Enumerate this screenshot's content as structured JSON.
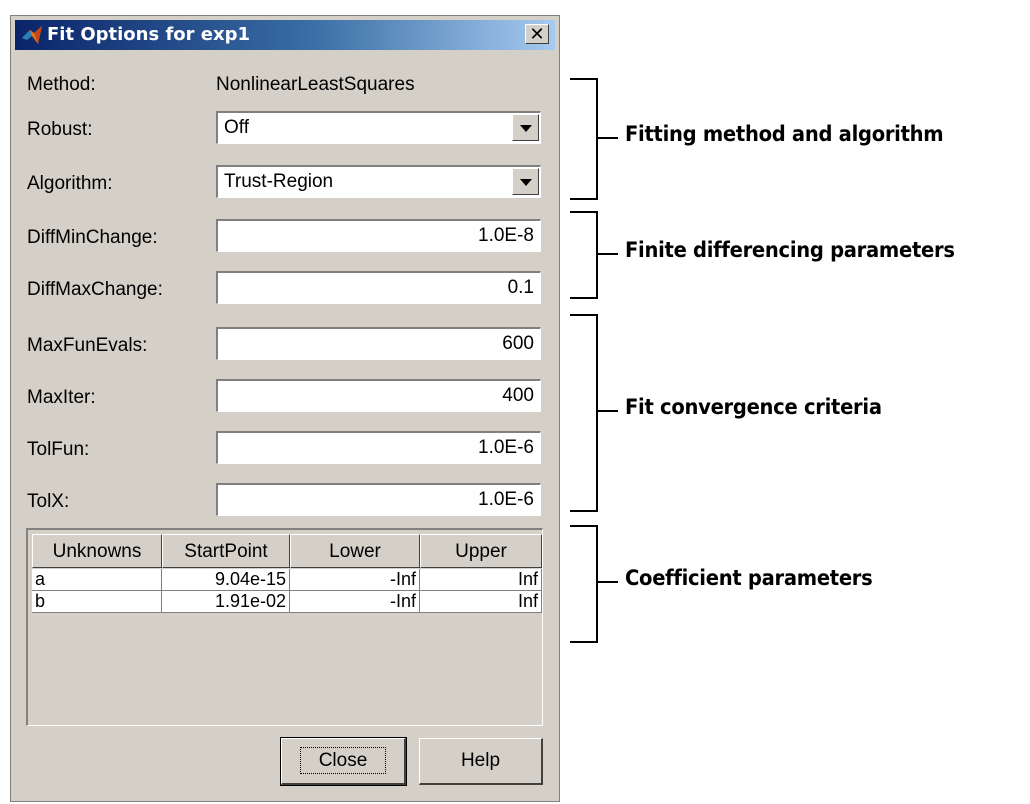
{
  "window": {
    "title": "Fit Options for exp1",
    "close_symbol": "✕",
    "icon": "matlab-logo-icon"
  },
  "form": {
    "method_label": "Method:",
    "method_value": "NonlinearLeastSquares",
    "robust_label": "Robust:",
    "robust_value": "Off",
    "algorithm_label": "Algorithm:",
    "algorithm_value": "Trust-Region",
    "diffminchange_label": "DiffMinChange:",
    "diffminchange_value": "1.0E-8",
    "diffmaxchange_label": "DiffMaxChange:",
    "diffmaxchange_value": "0.1",
    "maxfunevals_label": "MaxFunEvals:",
    "maxfunevals_value": "600",
    "maxiter_label": "MaxIter:",
    "maxiter_value": "400",
    "tolfun_label": "TolFun:",
    "tolfun_value": "1.0E-6",
    "tolx_label": "TolX:",
    "tolx_value": "1.0E-6"
  },
  "coeff_table": {
    "headers": [
      "Unknowns",
      "StartPoint",
      "Lower",
      "Upper"
    ],
    "rows": [
      [
        "a",
        "9.04e-15",
        "-Inf",
        "Inf"
      ],
      [
        "b",
        "1.91e-02",
        "-Inf",
        "Inf"
      ]
    ]
  },
  "buttons": {
    "close": "Close",
    "help": "Help"
  },
  "annotations": {
    "fitting": "Fitting method and algorithm",
    "finite": "Finite differencing parameters",
    "convergence": "Fit convergence criteria",
    "coefficient": "Coefficient parameters"
  }
}
